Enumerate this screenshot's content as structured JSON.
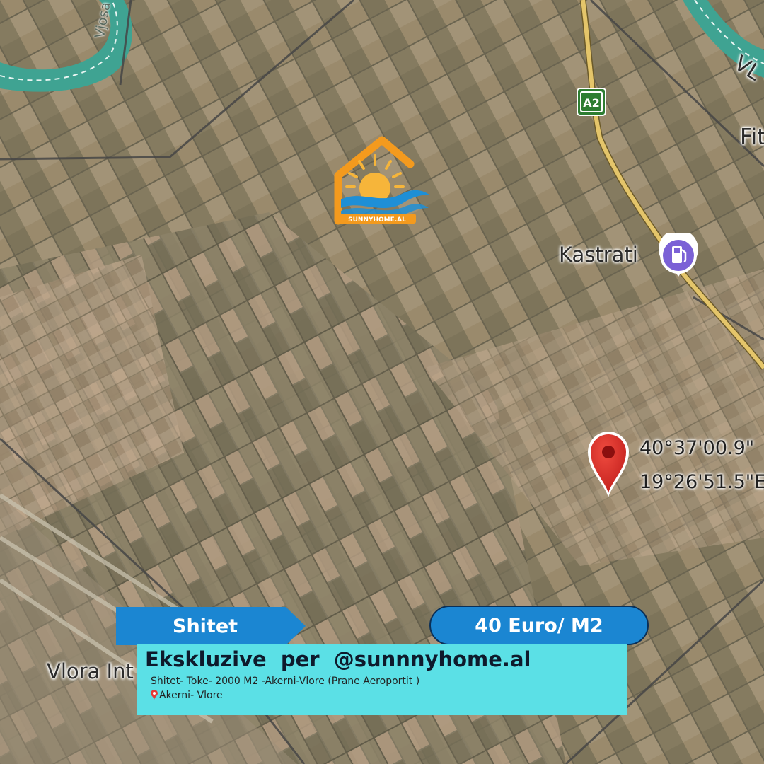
{
  "map": {
    "places": {
      "kastrati": "Kastrati",
      "fier": "Fit",
      "vlora_int": "Vlora Int",
      "river": "Vjosa",
      "road_partial": "VL"
    },
    "road_shield": "A2",
    "pin": {
      "icon": "location-pin-icon",
      "color": "#d93025",
      "latitude": "40°37'00.9\"",
      "longitude": "19°26'51.5\"E"
    },
    "poi_icon": "gas-station-icon",
    "colors": {
      "field_base": "#8f8667",
      "river": "#3fa392",
      "major_road": "#e4c56a",
      "minor_road": "#4a4a4a"
    }
  },
  "logo": {
    "icon": "sunnyhome-logo-icon",
    "text": "SUNNYHOME.AL",
    "colors": {
      "house": "#f39a1e",
      "sun": "#f6b53a",
      "waves": "#1e8fd6"
    }
  },
  "listing": {
    "tag": "Shitet",
    "price": "40 Euro/ M2",
    "title": "Ekskluzive  per  @sunnnyhome.al",
    "line1": "Shitet- Toke- 2000 M2 -Akerni-Vlore (Prane Aeroportit )",
    "location": "Akerni- Vlore",
    "colors": {
      "tag_bg": "#1b86d2",
      "price_bg": "#1b86d2",
      "box_bg": "#5be0e6"
    }
  }
}
